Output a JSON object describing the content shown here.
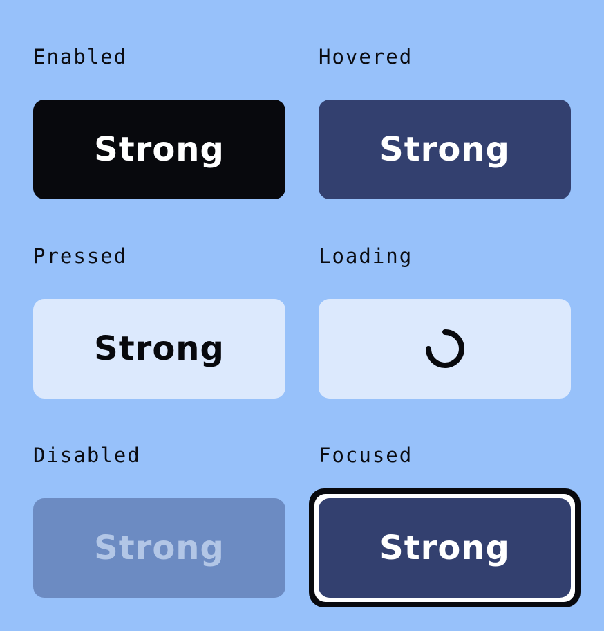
{
  "states": {
    "enabled": {
      "label": "Enabled",
      "button_text": "Strong"
    },
    "hovered": {
      "label": "Hovered",
      "button_text": "Strong"
    },
    "pressed": {
      "label": "Pressed",
      "button_text": "Strong"
    },
    "loading": {
      "label": "Loading",
      "icon": "loading-spinner-icon"
    },
    "disabled": {
      "label": "Disabled",
      "button_text": "Strong"
    },
    "focused": {
      "label": "Focused",
      "button_text": "Strong"
    }
  },
  "colors": {
    "background": "#97c1fa",
    "enabled_bg": "#08090d",
    "hovered_bg": "#33406f",
    "pressed_bg": "#dce9fd",
    "disabled_bg": "#6c8bc2",
    "disabled_text": "#b2c6e6",
    "focus_ring_outer": "#08090d",
    "focus_ring_inner": "#ffffff"
  }
}
